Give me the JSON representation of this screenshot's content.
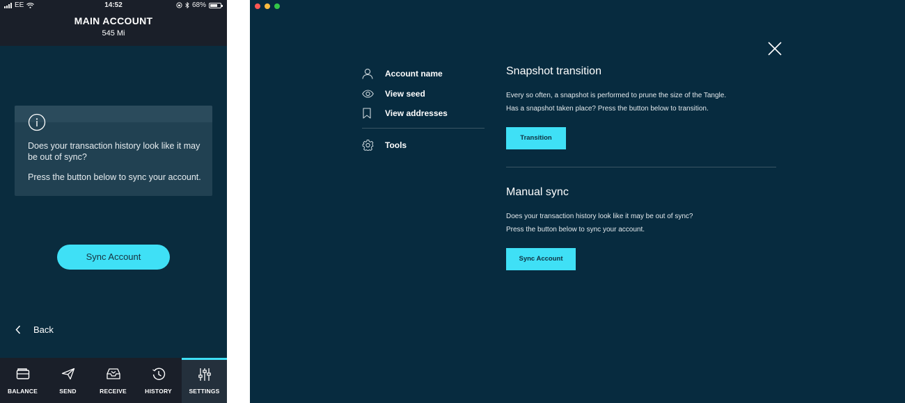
{
  "phone": {
    "status": {
      "carrier": "EE",
      "time": "14:52",
      "battery_percent": "68%",
      "battery_level": 0.68
    },
    "header": {
      "title": "MAIN ACCOUNT",
      "balance": "545 Mi"
    },
    "card": {
      "icon": "info-icon",
      "line1": "Does your transaction history look like it may be out of sync?",
      "line2": "Press the button below to sync your account."
    },
    "sync_button": "Sync Account",
    "back_label": "Back",
    "tabs": [
      {
        "label": "BALANCE",
        "icon": "wallet-icon"
      },
      {
        "label": "SEND",
        "icon": "paper-plane-icon"
      },
      {
        "label": "RECEIVE",
        "icon": "inbox-icon"
      },
      {
        "label": "HISTORY",
        "icon": "clock-icon"
      },
      {
        "label": "SETTINGS",
        "icon": "sliders-icon",
        "active": true
      }
    ],
    "accent_color": "#3fe0f6"
  },
  "desktop": {
    "menu": [
      {
        "label": "Account name",
        "icon": "user-icon"
      },
      {
        "label": "View seed",
        "icon": "eye-icon"
      },
      {
        "label": "View addresses",
        "icon": "bookmark-icon"
      },
      {
        "label": "Tools",
        "icon": "gear-icon"
      }
    ],
    "snapshot": {
      "title": "Snapshot transition",
      "line1": "Every so often, a snapshot is performed to prune the size of the Tangle.",
      "line2": "Has a snapshot taken place? Press the button below to transition.",
      "button": "Transition"
    },
    "manual": {
      "title": "Manual sync",
      "line1": "Does your transaction history look like it may be out of sync?",
      "line2": "Press the button below to sync your account.",
      "button": "Sync Account"
    },
    "colors": {
      "background": "#072b3f",
      "button": "#3fe0f6"
    }
  }
}
